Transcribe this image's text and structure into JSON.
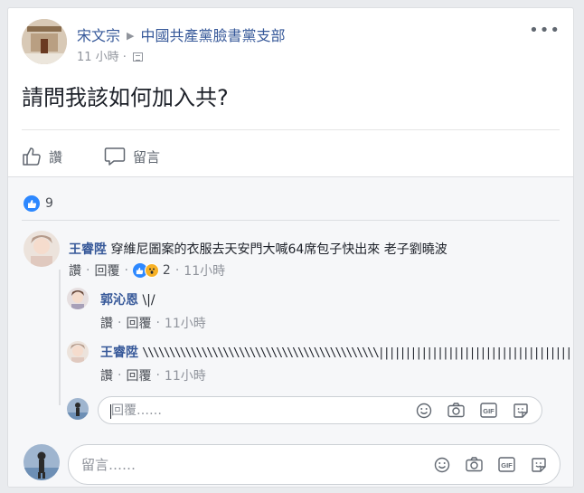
{
  "post": {
    "author": "宋文宗",
    "group": "中國共產黨臉書黨支部",
    "time": "11 小時 · ",
    "text": "請問我該如何加入共?",
    "more": "•••"
  },
  "actions": {
    "like_label": "讚",
    "comment_label": "留言"
  },
  "reactions": {
    "count": "9"
  },
  "comments": [
    {
      "author": "王睿陞",
      "text": "穿維尼圖案的衣服去天安門大喊64席包子快出來 老子劉曉波",
      "like": "讚",
      "reply": "回覆",
      "reaction_count": "2",
      "time": "11小時"
    }
  ],
  "replies": [
    {
      "author": "郭沁恩",
      "text": "\\|/",
      "like": "讚",
      "reply": "回覆",
      "time": "11小時"
    },
    {
      "author": "王睿陞",
      "text": "\\\\\\\\\\\\\\\\\\\\\\\\\\\\\\\\\\\\\\\\\\\\\\\\\\\\\\\\\\\\\\\\\\\\\\\\\\\\\\\\\\\\\\\\|||||||||||||||||||||||||||||||||||||||||||||////////////////////////",
      "like": "讚",
      "reply": "回覆",
      "time": "11小時"
    }
  ],
  "reply_input": {
    "placeholder": "回覆……"
  },
  "comment_input": {
    "placeholder": "留言……"
  },
  "colors": {
    "link": "#365899",
    "like_blue": "#2d88ff",
    "background": "#e9ebee"
  }
}
